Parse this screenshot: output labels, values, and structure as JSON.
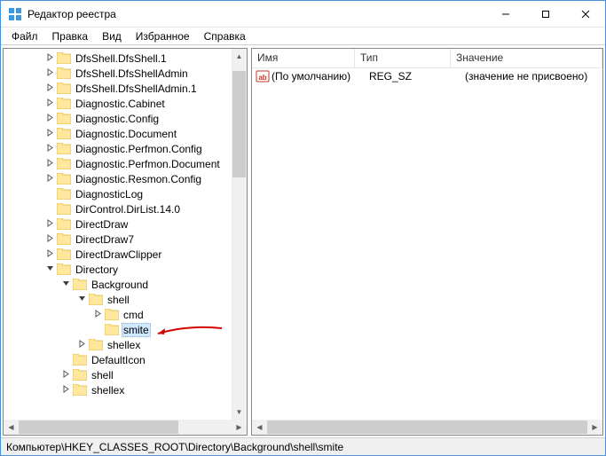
{
  "window": {
    "title": "Редактор реестра"
  },
  "menu": {
    "file": "Файл",
    "edit": "Правка",
    "view": "Вид",
    "favorites": "Избранное",
    "help": "Справка"
  },
  "tree": [
    {
      "depth": 2,
      "exp": "closed",
      "label": "DfsShell.DfsShell.1"
    },
    {
      "depth": 2,
      "exp": "closed",
      "label": "DfsShell.DfsShellAdmin"
    },
    {
      "depth": 2,
      "exp": "closed",
      "label": "DfsShell.DfsShellAdmin.1"
    },
    {
      "depth": 2,
      "exp": "closed",
      "label": "Diagnostic.Cabinet"
    },
    {
      "depth": 2,
      "exp": "closed",
      "label": "Diagnostic.Config"
    },
    {
      "depth": 2,
      "exp": "closed",
      "label": "Diagnostic.Document"
    },
    {
      "depth": 2,
      "exp": "closed",
      "label": "Diagnostic.Perfmon.Config"
    },
    {
      "depth": 2,
      "exp": "closed",
      "label": "Diagnostic.Perfmon.Document"
    },
    {
      "depth": 2,
      "exp": "closed",
      "label": "Diagnostic.Resmon.Config"
    },
    {
      "depth": 2,
      "exp": "none",
      "label": "DiagnosticLog"
    },
    {
      "depth": 2,
      "exp": "none",
      "label": "DirControl.DirList.14.0"
    },
    {
      "depth": 2,
      "exp": "closed",
      "label": "DirectDraw"
    },
    {
      "depth": 2,
      "exp": "closed",
      "label": "DirectDraw7"
    },
    {
      "depth": 2,
      "exp": "closed",
      "label": "DirectDrawClipper"
    },
    {
      "depth": 2,
      "exp": "open",
      "label": "Directory"
    },
    {
      "depth": 3,
      "exp": "open",
      "label": "Background"
    },
    {
      "depth": 4,
      "exp": "open",
      "label": "shell"
    },
    {
      "depth": 5,
      "exp": "closed",
      "label": "cmd"
    },
    {
      "depth": 5,
      "exp": "none",
      "label": "smite",
      "selected": true,
      "arrow": true
    },
    {
      "depth": 4,
      "exp": "closed",
      "label": "shellex"
    },
    {
      "depth": 3,
      "exp": "none",
      "label": "DefaultIcon"
    },
    {
      "depth": 3,
      "exp": "closed",
      "label": "shell"
    },
    {
      "depth": 3,
      "exp": "closed",
      "label": "shellex"
    }
  ],
  "columns": {
    "name": "Имя",
    "type": "Тип",
    "value": "Значение"
  },
  "values": [
    {
      "name": "(По умолчанию)",
      "type": "REG_SZ",
      "value": "(значение не присвоено)"
    }
  ],
  "status": "Компьютер\\HKEY_CLASSES_ROOT\\Directory\\Background\\shell\\smite"
}
